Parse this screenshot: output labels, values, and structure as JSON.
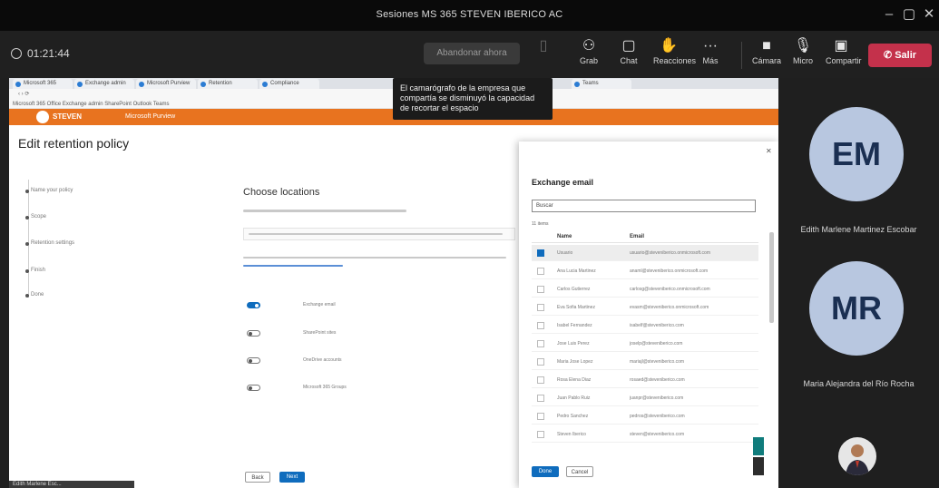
{
  "window": {
    "title": "Sesiones MS 365 STEVEN IBERICO AC",
    "minimize": "–",
    "maximize": "▢",
    "close": "✕"
  },
  "meeting": {
    "timer": "01:21:44",
    "search_placeholder": "Abandonar ahora",
    "toolbar": [
      {
        "label": "Grab",
        "icon": "grid-icon"
      },
      {
        "label": "Chat",
        "icon": "chat-icon"
      },
      {
        "label": "Reacciones",
        "icon": "hand-icon"
      },
      {
        "label": "Más",
        "icon": "more-icon"
      },
      {
        "label": "Cámara",
        "icon": "camera-icon"
      },
      {
        "label": "Micro",
        "icon": "mic-icon"
      },
      {
        "label": "Compartir",
        "icon": "share-icon"
      }
    ],
    "leave_label": "Salir"
  },
  "browser": {
    "tabs": [
      "Microsoft 365",
      "Exchange admin",
      "Microsoft Purview",
      "Retention",
      "Compliance",
      "Teams"
    ],
    "bookmarks": "Microsoft 365   Office   Exchange admin   SharePoint   Outlook   Teams",
    "brand": "STEVEN",
    "app_name": "Microsoft Purview"
  },
  "policy": {
    "title": "Edit retention policy",
    "steps": [
      "Name your policy",
      "Scope",
      "Retention settings",
      "Finish",
      "Done"
    ],
    "heading": "Choose locations",
    "toggles": [
      {
        "state": "on",
        "label": "Exchange email"
      },
      {
        "state": "off",
        "label": "SharePoint sites"
      },
      {
        "state": "off",
        "label": "OneDrive accounts"
      },
      {
        "state": "off",
        "label": "Microsoft 365 Groups"
      }
    ],
    "back_label": "Back",
    "next_label": "Next"
  },
  "panel": {
    "title": "Exchange email",
    "search_value": "Buscar",
    "count": "11 items",
    "col_name": "Name",
    "col_email": "Email",
    "rows": [
      {
        "name": "Usuario",
        "email": "usuario@steveniberico.onmicrosoft.com",
        "selected": true
      },
      {
        "name": "Ana Lucia Martinez",
        "email": "anaml@steveniberico.onmicrosoft.com",
        "selected": false
      },
      {
        "name": "Carlos Gutierrez",
        "email": "carlosg@steveniberico.onmicrosoft.com",
        "selected": false
      },
      {
        "name": "Eva Sofia Martinez",
        "email": "evasm@steveniberico.onmicrosoft.com",
        "selected": false
      },
      {
        "name": "Isabel Fernandez",
        "email": "isabelf@steveniberico.com",
        "selected": false
      },
      {
        "name": "Jose Luis Perez",
        "email": "joselp@steveniberico.com",
        "selected": false
      },
      {
        "name": "Maria Jose Lopez",
        "email": "mariajl@steveniberico.com",
        "selected": false
      },
      {
        "name": "Rosa Elena Diaz",
        "email": "rosaed@steveniberico.com",
        "selected": false
      },
      {
        "name": "Juan Pablo Ruiz",
        "email": "juanpr@steveniberico.com",
        "selected": false
      },
      {
        "name": "Pedro Sanchez",
        "email": "pedros@steveniberico.com",
        "selected": false
      },
      {
        "name": "Steven Iberico",
        "email": "steven@steveniberico.com",
        "selected": false
      }
    ],
    "done_label": "Done",
    "cancel_label": "Cancel"
  },
  "tooltip": "El camarógrafo de la empresa que compartía se disminuyó la capacidad de recortar el espacio",
  "bottom_label": "Edith Marlene Esc...",
  "participants": [
    {
      "initials": "EM",
      "name": "Edith Marlene Martinez Escobar"
    },
    {
      "initials": "MR",
      "name": "Maria Alejandra del Río Rocha"
    }
  ]
}
